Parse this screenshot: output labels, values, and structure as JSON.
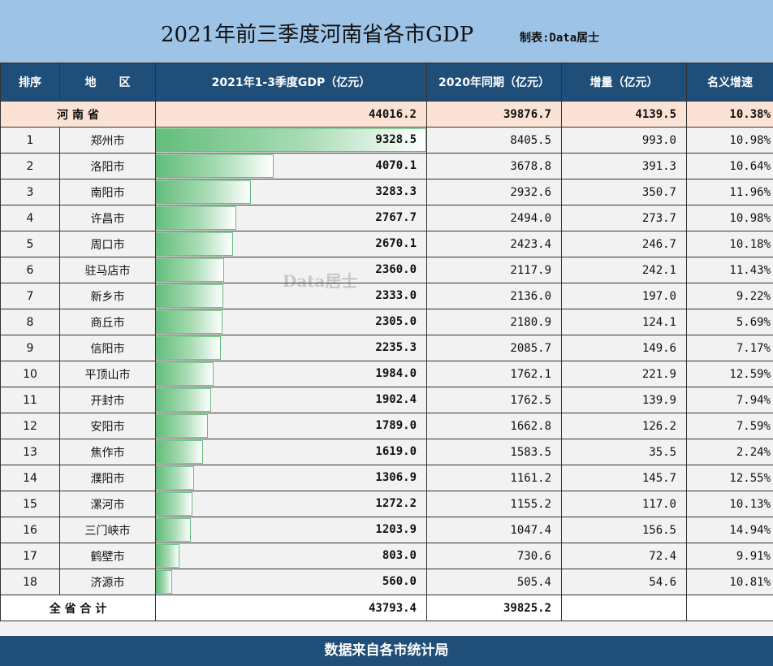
{
  "title": "2021年前三季度河南省各市GDP",
  "maker": "制表:Data居士",
  "watermark": "Data居士",
  "headers": {
    "rank": "排序",
    "region": "地　　区",
    "gdp": "2021年1-3季度GDP（亿元）",
    "prev": "2020年同期（亿元）",
    "increase": "增量（亿元）",
    "growth": "名义增速"
  },
  "province": {
    "name": "河 南 省",
    "gdp": "44016.2",
    "prev": "39876.7",
    "increase": "4139.5",
    "growth": "10.38%"
  },
  "rows": [
    {
      "rank": "1",
      "city": "郑州市",
      "gdp": "9328.5",
      "prev": "8405.5",
      "increase": "993.0",
      "growth": "10.98%"
    },
    {
      "rank": "2",
      "city": "洛阳市",
      "gdp": "4070.1",
      "prev": "3678.8",
      "increase": "391.3",
      "growth": "10.64%"
    },
    {
      "rank": "3",
      "city": "南阳市",
      "gdp": "3283.3",
      "prev": "2932.6",
      "increase": "350.7",
      "growth": "11.96%"
    },
    {
      "rank": "4",
      "city": "许昌市",
      "gdp": "2767.7",
      "prev": "2494.0",
      "increase": "273.7",
      "growth": "10.98%"
    },
    {
      "rank": "5",
      "city": "周口市",
      "gdp": "2670.1",
      "prev": "2423.4",
      "increase": "246.7",
      "growth": "10.18%"
    },
    {
      "rank": "6",
      "city": "驻马店市",
      "gdp": "2360.0",
      "prev": "2117.9",
      "increase": "242.1",
      "growth": "11.43%"
    },
    {
      "rank": "7",
      "city": "新乡市",
      "gdp": "2333.0",
      "prev": "2136.0",
      "increase": "197.0",
      "growth": "9.22%"
    },
    {
      "rank": "8",
      "city": "商丘市",
      "gdp": "2305.0",
      "prev": "2180.9",
      "increase": "124.1",
      "growth": "5.69%"
    },
    {
      "rank": "9",
      "city": "信阳市",
      "gdp": "2235.3",
      "prev": "2085.7",
      "increase": "149.6",
      "growth": "7.17%"
    },
    {
      "rank": "10",
      "city": "平顶山市",
      "gdp": "1984.0",
      "prev": "1762.1",
      "increase": "221.9",
      "growth": "12.59%"
    },
    {
      "rank": "11",
      "city": "开封市",
      "gdp": "1902.4",
      "prev": "1762.5",
      "increase": "139.9",
      "growth": "7.94%"
    },
    {
      "rank": "12",
      "city": "安阳市",
      "gdp": "1789.0",
      "prev": "1662.8",
      "increase": "126.2",
      "growth": "7.59%"
    },
    {
      "rank": "13",
      "city": "焦作市",
      "gdp": "1619.0",
      "prev": "1583.5",
      "increase": "35.5",
      "growth": "2.24%"
    },
    {
      "rank": "14",
      "city": "濮阳市",
      "gdp": "1306.9",
      "prev": "1161.2",
      "increase": "145.7",
      "growth": "12.55%"
    },
    {
      "rank": "15",
      "city": "漯河市",
      "gdp": "1272.2",
      "prev": "1155.2",
      "increase": "117.0",
      "growth": "10.13%"
    },
    {
      "rank": "16",
      "city": "三门峡市",
      "gdp": "1203.9",
      "prev": "1047.4",
      "increase": "156.5",
      "growth": "14.94%"
    },
    {
      "rank": "17",
      "city": "鹤壁市",
      "gdp": "803.0",
      "prev": "730.6",
      "increase": "72.4",
      "growth": "9.91%"
    },
    {
      "rank": "18",
      "city": "济源市",
      "gdp": "560.0",
      "prev": "505.4",
      "increase": "54.6",
      "growth": "10.81%"
    }
  ],
  "total": {
    "label": "全 省 合 计",
    "gdp": "43793.4",
    "prev": "39825.2"
  },
  "footer": "数据来自各市统计局",
  "colors": {
    "header_bg": "#1f4e79",
    "title_bg": "#9dc3e6",
    "province_bg": "#fbe2d5",
    "bar_color": "#63be7b"
  }
}
